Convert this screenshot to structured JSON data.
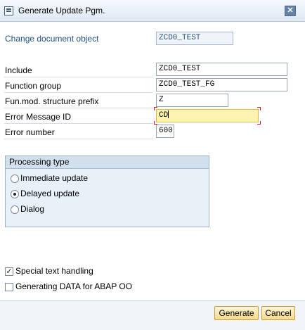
{
  "window": {
    "title": "Generate Update Pgm.",
    "close_symbol": "✕"
  },
  "form": {
    "change_doc": {
      "label": "Change document object",
      "value": "ZCD0_TEST"
    },
    "include": {
      "label": "Include",
      "value": "ZCD0_TEST"
    },
    "function_group": {
      "label": "Function group",
      "value": "ZCD0_TEST_FG"
    },
    "prefix": {
      "label": "Fun.mod. structure prefix",
      "value": "Z"
    },
    "error_msg_id": {
      "label": "Error Message ID",
      "value": "CD"
    },
    "error_number": {
      "label": "Error number",
      "value": "600"
    }
  },
  "processing": {
    "title": "Processing type",
    "options": [
      {
        "label": "Immediate update",
        "selected": false
      },
      {
        "label": "Delayed update",
        "selected": true
      },
      {
        "label": "Dialog",
        "selected": false
      }
    ]
  },
  "options": {
    "special_text": {
      "label": "Special text handling",
      "checked": true,
      "mark": "✓"
    },
    "abap_oo": {
      "label": "Generating DATA for ABAP OO",
      "checked": false,
      "mark": ""
    }
  },
  "buttons": {
    "generate": "Generate",
    "cancel": "Cancel"
  },
  "colors": {
    "title_bar": "#dfe9f4",
    "label_blue": "#1f4f8a",
    "focus_field": "#fff3b0",
    "button": "#f5d98c"
  }
}
